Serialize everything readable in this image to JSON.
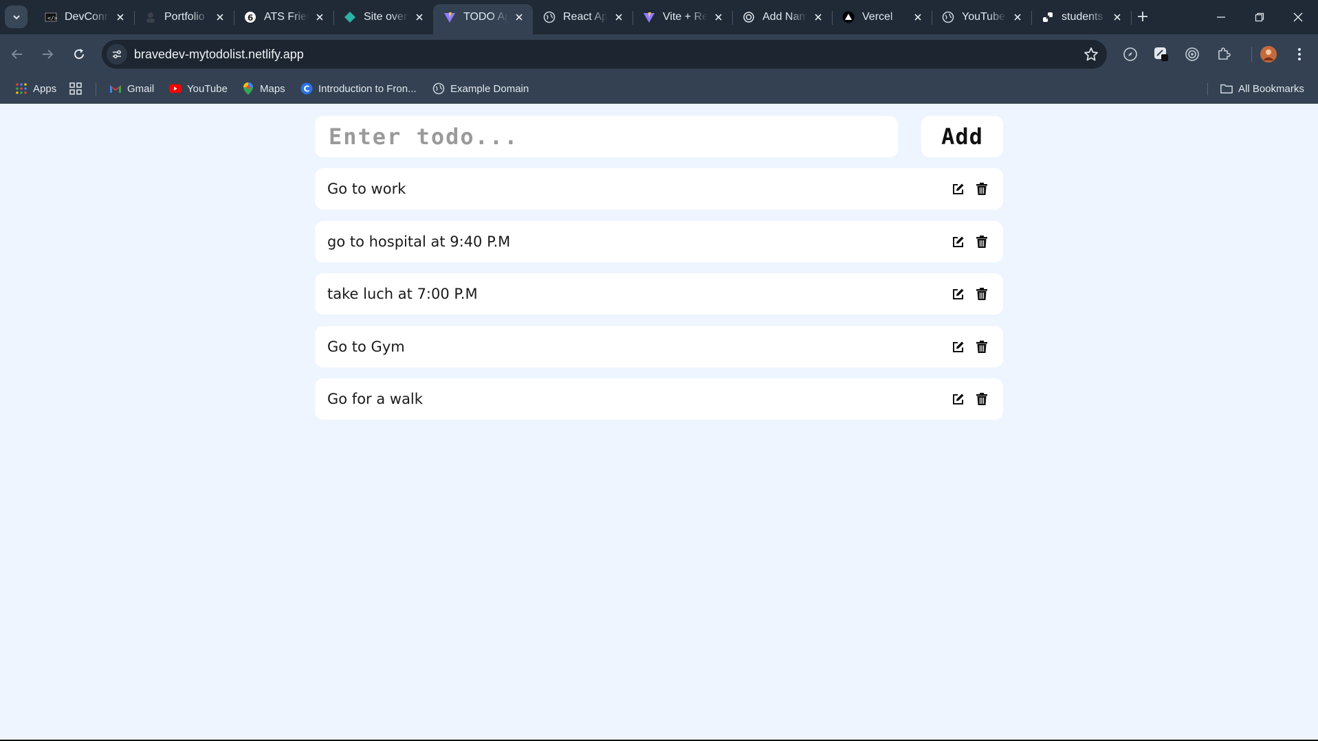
{
  "browser": {
    "tabs": [
      {
        "title": "DevConnector",
        "icon": "devconnector-favicon"
      },
      {
        "title": "Portfolio",
        "icon": "portfolio-favicon"
      },
      {
        "title": "ATS Friendly",
        "icon": "ats-favicon"
      },
      {
        "title": "Site overview",
        "icon": "netlify-favicon"
      },
      {
        "title": "TODO App",
        "icon": "vite-favicon",
        "active": true
      },
      {
        "title": "React App",
        "icon": "globe-favicon"
      },
      {
        "title": "Vite + React",
        "icon": "vite-favicon"
      },
      {
        "title": "Add Name",
        "icon": "openai-favicon"
      },
      {
        "title": "Vercel",
        "icon": "vercel-favicon"
      },
      {
        "title": "YouTube",
        "icon": "globe-favicon"
      },
      {
        "title": "students",
        "icon": "link-favicon"
      }
    ],
    "url": "bravedev-mytodolist.netlify.app",
    "bookmarks": {
      "apps": "Apps",
      "gmail": "Gmail",
      "youtube": "YouTube",
      "maps": "Maps",
      "intro": "Introduction to Fron...",
      "example": "Example Domain",
      "all": "All Bookmarks"
    }
  },
  "app": {
    "input_placeholder": "Enter todo...",
    "input_value": "",
    "add_label": "Add",
    "todos": [
      "Go to work",
      "go to hospital at 9:40 P.M",
      "take luch at 7:00 P.M",
      "Go to Gym",
      "Go for a walk"
    ]
  },
  "colors": {
    "page_bg": "#eef5ff",
    "card_bg": "#ffffff",
    "chrome_dark": "#202a36",
    "chrome_toolbar": "#344152"
  }
}
